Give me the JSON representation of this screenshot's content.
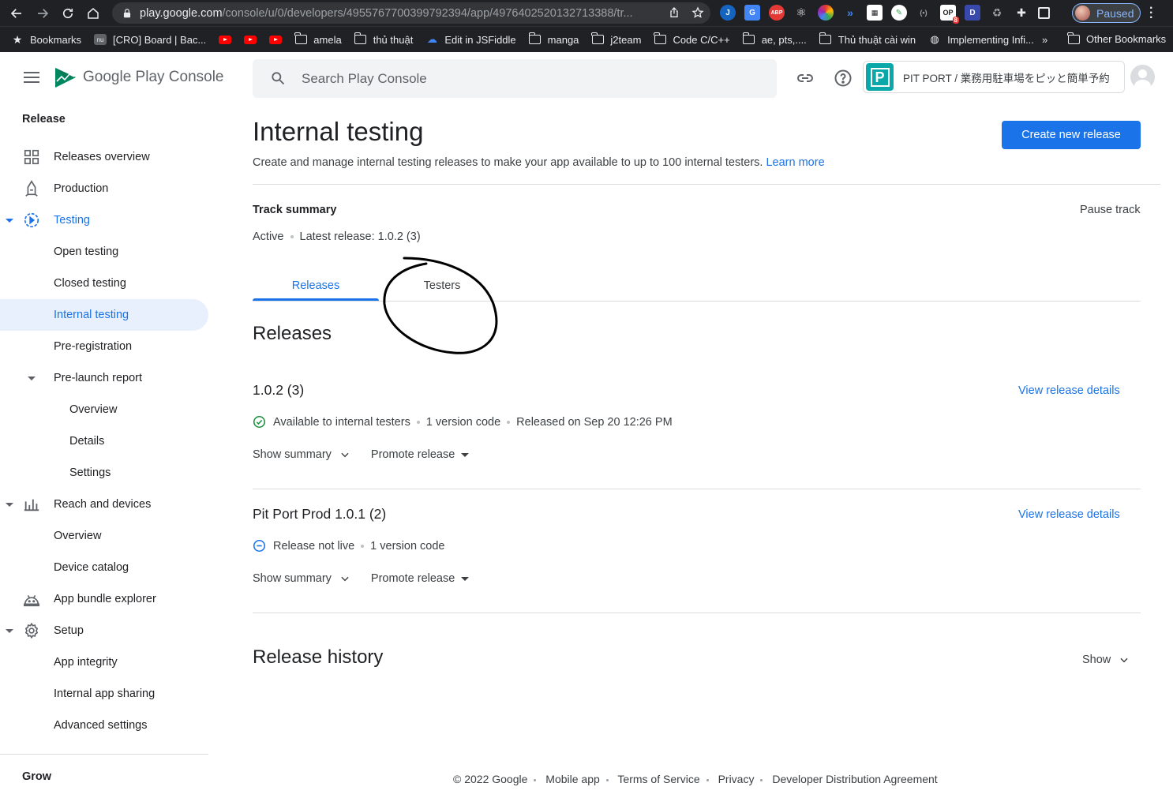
{
  "browser": {
    "url_host": "play.google.com",
    "url_path": "/console/u/0/developers/4955767700399792394/app/4976402520132713388/tr...",
    "profile_status": "Paused",
    "bookmarks": [
      {
        "icon": "star-icon",
        "label": "Bookmarks"
      },
      {
        "icon": "board-icon",
        "label": "[CRO] Board | Bac..."
      },
      {
        "icon": "youtube-icon",
        "label": ""
      },
      {
        "icon": "youtube-icon",
        "label": ""
      },
      {
        "icon": "youtube-icon",
        "label": ""
      },
      {
        "icon": "folder-icon",
        "label": "amela"
      },
      {
        "icon": "folder-icon",
        "label": "thủ thuật"
      },
      {
        "icon": "jsfiddle-icon",
        "label": "Edit in JSFiddle"
      },
      {
        "icon": "folder-icon",
        "label": "manga"
      },
      {
        "icon": "folder-icon",
        "label": "j2team"
      },
      {
        "icon": "folder-icon",
        "label": "Code C/C++"
      },
      {
        "icon": "folder-icon",
        "label": "ae, pts,...."
      },
      {
        "icon": "folder-icon",
        "label": "Thủ thuật cài win"
      },
      {
        "icon": "globe-icon",
        "label": "Implementing Infi..."
      }
    ],
    "bookmarks_more": "»",
    "other_bookmarks": "Other Bookmarks"
  },
  "header": {
    "brand": "Google Play Console",
    "search_placeholder": "Search Play Console",
    "app_name": "PIT PORT / 業務用駐車場をピッと簡単予約",
    "app_logo_letter": "P"
  },
  "sidebar": {
    "section_release": "Release",
    "items": [
      {
        "label": "Releases overview",
        "icon": "dashboard-icon"
      },
      {
        "label": "Production",
        "icon": "production-icon"
      },
      {
        "label": "Testing",
        "icon": "testing-icon"
      },
      {
        "label": "Open testing"
      },
      {
        "label": "Closed testing"
      },
      {
        "label": "Internal testing"
      },
      {
        "label": "Pre-registration"
      },
      {
        "label": "Pre-launch report"
      },
      {
        "label": "Overview"
      },
      {
        "label": "Details"
      },
      {
        "label": "Settings"
      },
      {
        "label": "Reach and devices",
        "icon": "bar-chart-icon"
      },
      {
        "label": "Overview"
      },
      {
        "label": "Device catalog"
      },
      {
        "label": "App bundle explorer",
        "icon": "android-icon"
      },
      {
        "label": "Setup",
        "icon": "gear-icon"
      },
      {
        "label": "App integrity"
      },
      {
        "label": "Internal app sharing"
      },
      {
        "label": "Advanced settings"
      }
    ],
    "section_grow": "Grow"
  },
  "main": {
    "title": "Internal testing",
    "description": "Create and manage internal testing releases to make your app available to up to 100 internal testers.",
    "learn_more": "Learn more",
    "create_button": "Create new release",
    "track_summary_title": "Track summary",
    "pause_track": "Pause track",
    "track_status": "Active",
    "latest_release": "Latest release: 1.0.2 (3)",
    "tabs": [
      {
        "label": "Releases",
        "active": true
      },
      {
        "label": "Testers",
        "active": false
      }
    ],
    "releases_title": "Releases",
    "releases": [
      {
        "name": "1.0.2 (3)",
        "view_details": "View release details",
        "status": "Available to internal testers",
        "status_icon": "check-circle-icon",
        "version_codes": "1 version code",
        "released_on": "Released on Sep 20 12:26 PM",
        "show_summary": "Show summary",
        "promote": "Promote release"
      },
      {
        "name": "Pit Port Prod 1.0.1 (2)",
        "view_details": "View release details",
        "status": "Release not live",
        "status_icon": "minus-circle-icon",
        "version_codes": "1 version code",
        "released_on": "",
        "show_summary": "Show summary",
        "promote": "Promote release"
      }
    ],
    "history_title": "Release history",
    "history_show": "Show"
  },
  "footer": {
    "copyright": "© 2022 Google",
    "links": [
      "Mobile app",
      "Terms of Service",
      "Privacy",
      "Developer Distribution Agreement"
    ]
  },
  "colors": {
    "accent": "#1a73e8",
    "active_nav_bg": "#e8f0fe",
    "success": "#1e8e3e",
    "app_logo": "#0aa8a8"
  }
}
